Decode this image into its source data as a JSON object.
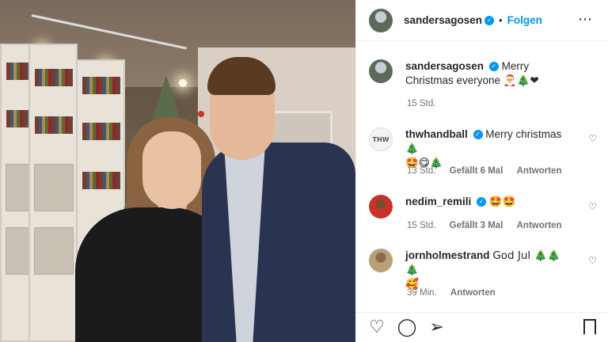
{
  "header": {
    "username": "sandersagosen",
    "verified_mark": "✓",
    "separator": "•",
    "follow_label": "Folgen",
    "more_icon": "⋯"
  },
  "caption": {
    "username": "sandersagosen",
    "verified_mark": "✓",
    "text": "Merry Christmas everyone",
    "emoji": "🎅🎄❤",
    "time": "15 Std."
  },
  "comments": [
    {
      "username": "thwhandball",
      "avatar_text": "THW",
      "verified_mark": "✓",
      "text": "Merry christmas 🎄",
      "text2": "🤩😋🎄",
      "time": "13 Std.",
      "likes": "Gefällt 6 Mal",
      "reply": "Antworten",
      "like_icon": "♡"
    },
    {
      "username": "nedim_remili",
      "verified_mark": "✓",
      "text": "🤩🤩",
      "time": "15 Std.",
      "likes": "Gefällt 3 Mal",
      "reply": "Antworten",
      "like_icon": "♡"
    },
    {
      "username": "jornholmestrand",
      "text": "God Jul 🎄🎄🎄",
      "text2": "🥰",
      "time": "39 Min.",
      "reply": "Antworten",
      "like_icon": "♡"
    }
  ],
  "actions": {
    "like_icon": "♡",
    "comment_icon": "◯",
    "share_icon": "➢"
  },
  "colors": {
    "link_blue": "#0095f6",
    "text": "#262626",
    "muted": "#737373"
  }
}
